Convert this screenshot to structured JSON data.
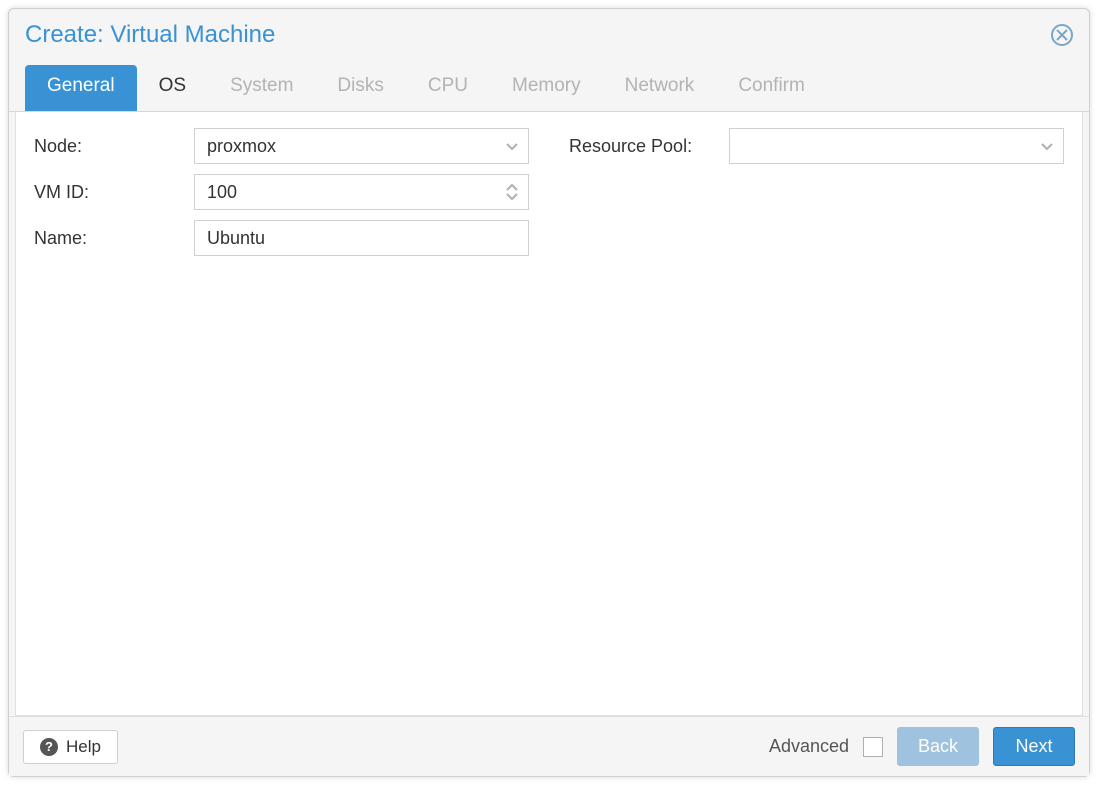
{
  "dialog": {
    "title": "Create: Virtual Machine"
  },
  "tabs": [
    {
      "label": "General",
      "state": "active"
    },
    {
      "label": "OS",
      "state": "enabled"
    },
    {
      "label": "System",
      "state": "disabled"
    },
    {
      "label": "Disks",
      "state": "disabled"
    },
    {
      "label": "CPU",
      "state": "disabled"
    },
    {
      "label": "Memory",
      "state": "disabled"
    },
    {
      "label": "Network",
      "state": "disabled"
    },
    {
      "label": "Confirm",
      "state": "disabled"
    }
  ],
  "form": {
    "node": {
      "label": "Node:",
      "value": "proxmox"
    },
    "vmid": {
      "label": "VM ID:",
      "value": "100"
    },
    "name": {
      "label": "Name:",
      "value": "Ubuntu"
    },
    "resource_pool": {
      "label": "Resource Pool:",
      "value": ""
    }
  },
  "footer": {
    "help": "Help",
    "advanced": "Advanced",
    "advanced_checked": false,
    "back": "Back",
    "next": "Next"
  }
}
